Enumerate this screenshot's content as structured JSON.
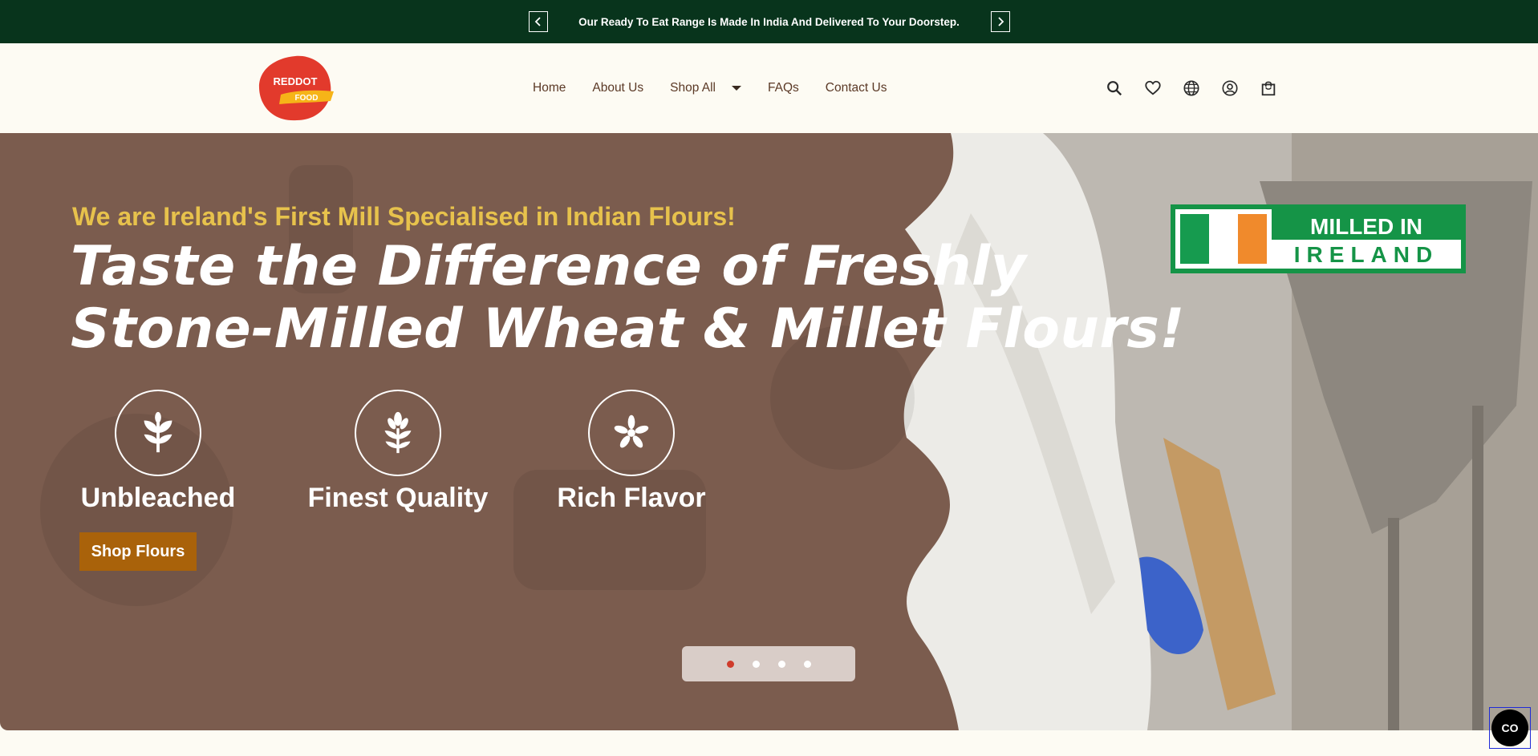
{
  "announcement": {
    "text": "Our Ready To Eat Range Is Made In India And Delivered To Your Doorstep."
  },
  "brand": {
    "logo_line1": "REDDOT",
    "logo_line2": "FOOD",
    "logo_color": "#e23a2c"
  },
  "nav": {
    "items": [
      {
        "label": "Home"
      },
      {
        "label": "About Us"
      },
      {
        "label": "Shop All"
      },
      {
        "label": "FAQs"
      },
      {
        "label": "Contact Us"
      }
    ]
  },
  "header_icons": [
    "search-icon",
    "heart-icon",
    "globe-icon",
    "user-icon",
    "bag-icon"
  ],
  "hero": {
    "tagline": "We are Ireland's First Mill Specialised in Indian Flours!",
    "headline_line1": "Taste the Difference of Freshly",
    "headline_line2": "Stone-Milled Wheat & Millet Flours!",
    "features": [
      {
        "label": "Unbleached",
        "icon": "sprout-icon"
      },
      {
        "label": "Finest Quality",
        "icon": "flower-stem-icon"
      },
      {
        "label": "Rich Flavor",
        "icon": "blossom-icon"
      }
    ],
    "cta_label": "Shop Flours",
    "badge_line1": "MILLED IN",
    "badge_line2": "IRELAND",
    "slides_total": 4,
    "active_slide": 1
  },
  "colors": {
    "announce_bg": "#08341c",
    "hero_bg": "#7b5c4e",
    "accent_yellow": "#e7c24c",
    "cta_bg": "#a9620a",
    "active_dot": "#cf3b2b"
  },
  "chat": {
    "label": "CO"
  }
}
